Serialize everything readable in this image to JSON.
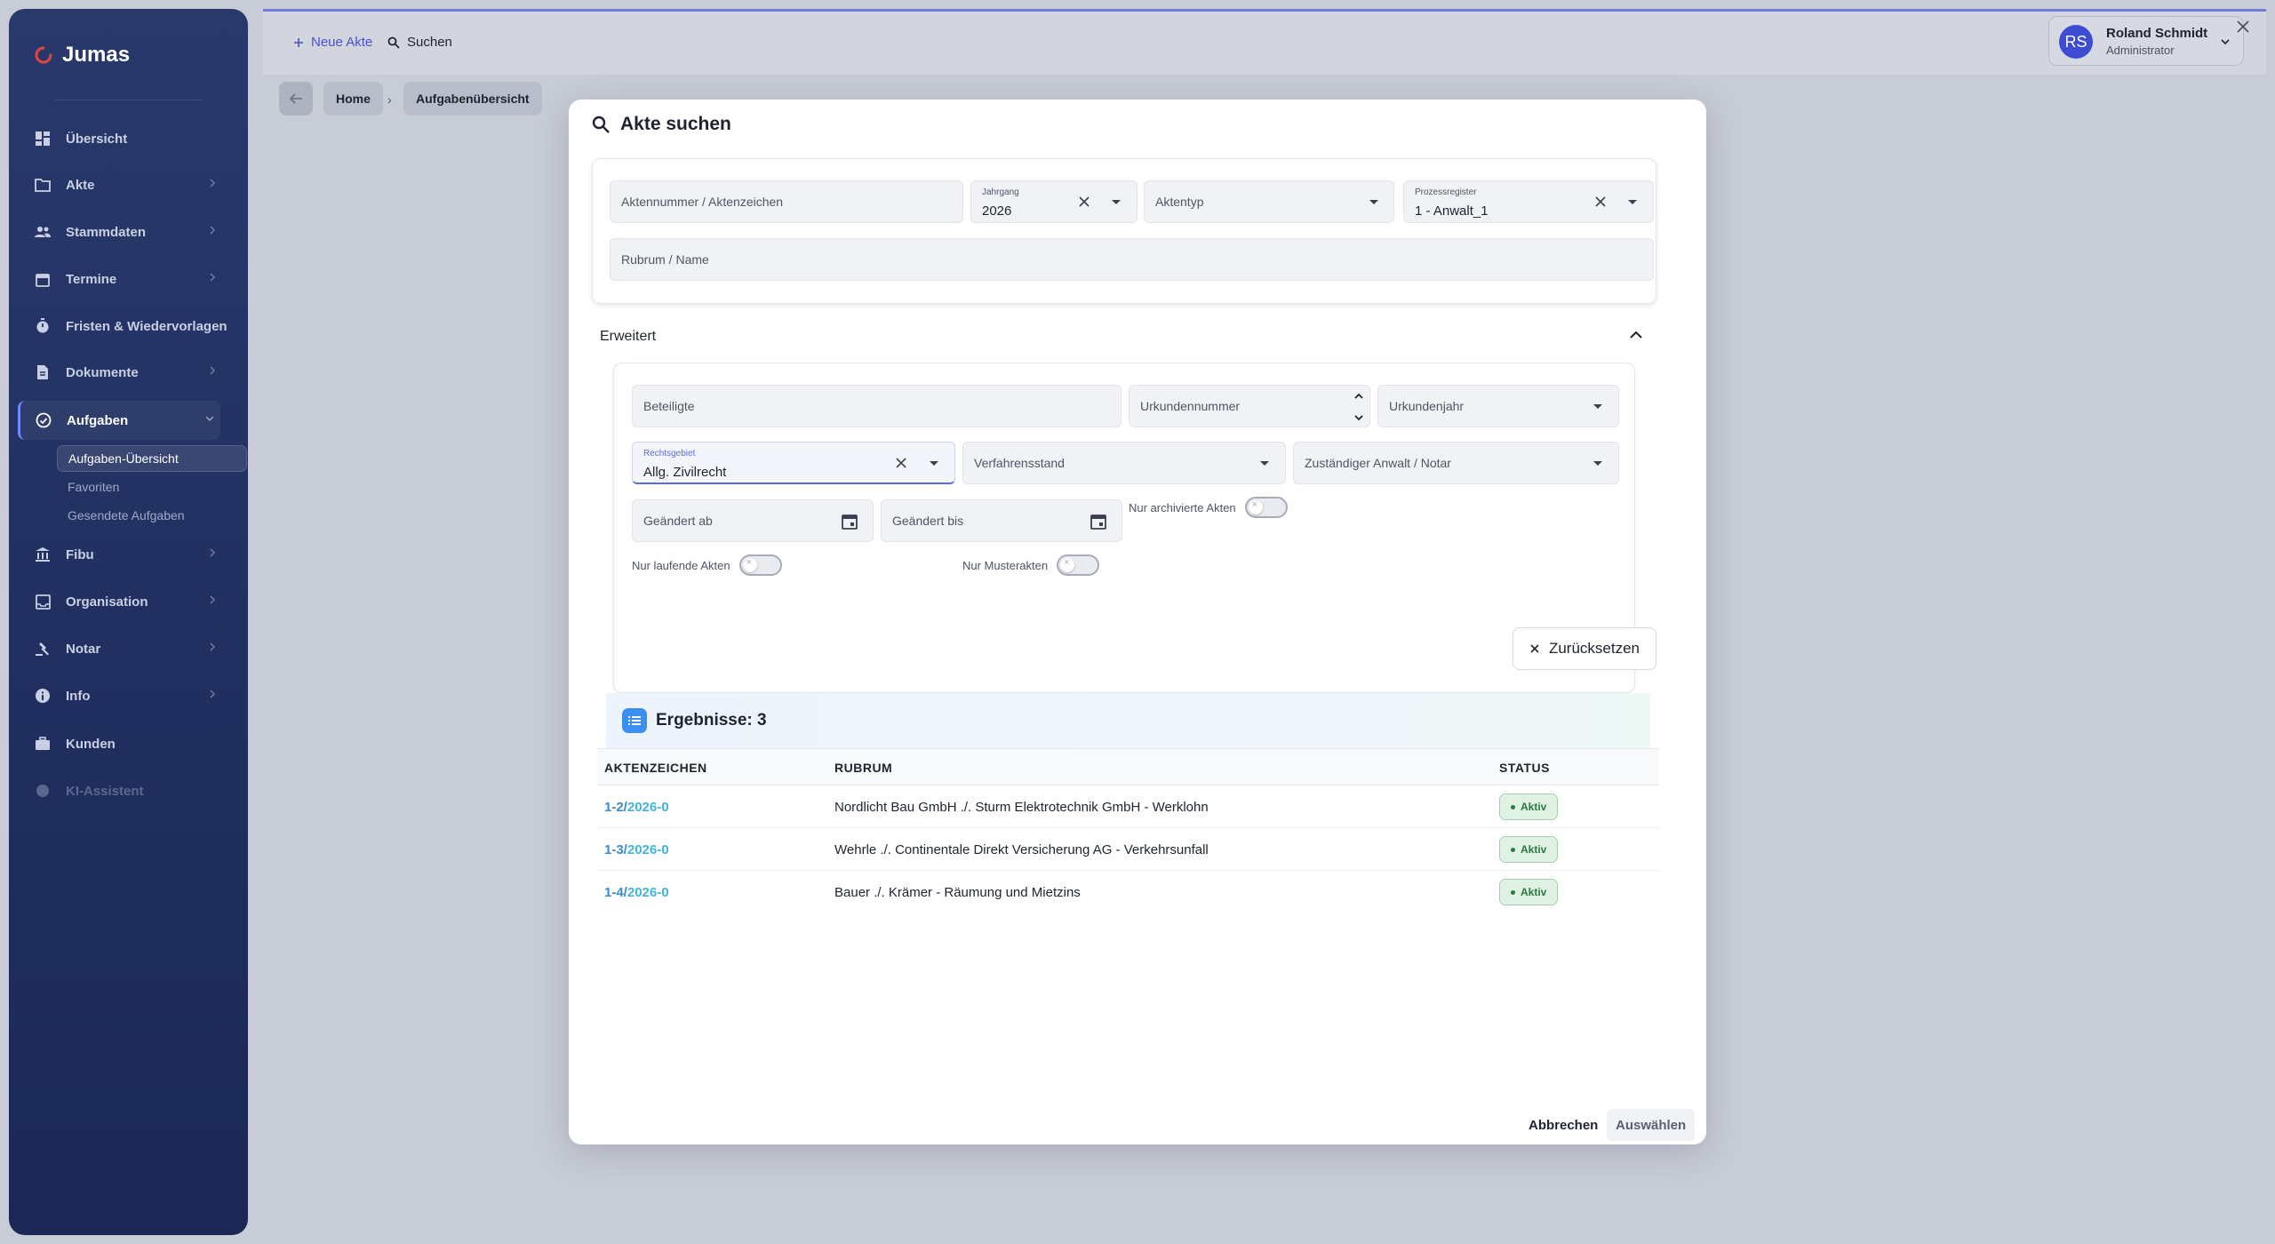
{
  "app": {
    "name": "Jumas"
  },
  "sidebar": {
    "items": [
      {
        "label": "Übersicht",
        "icon": "dashboard-icon"
      },
      {
        "label": "Akte",
        "icon": "folder-icon"
      },
      {
        "label": "Stammdaten",
        "icon": "people-icon"
      },
      {
        "label": "Termine",
        "icon": "calendar-icon"
      },
      {
        "label": "Fristen & Wiedervorlagen",
        "icon": "timer-icon"
      },
      {
        "label": "Dokumente",
        "icon": "document-icon"
      },
      {
        "label": "Aufgaben",
        "icon": "check-circle-icon"
      },
      {
        "label": "Fibu",
        "icon": "bank-icon"
      },
      {
        "label": "Organisation",
        "icon": "inbox-icon"
      },
      {
        "label": "Notar",
        "icon": "gavel-icon"
      },
      {
        "label": "Info",
        "icon": "info-icon"
      },
      {
        "label": "Kunden",
        "icon": "briefcase-icon"
      },
      {
        "label": "KI-Assistent",
        "icon": "sparkle-icon"
      }
    ],
    "subitems": [
      "Aufgaben-Übersicht",
      "Favoriten",
      "Gesendete Aufgaben"
    ]
  },
  "topbar": {
    "new_file": "Neue Akte",
    "search": "Suchen",
    "user": {
      "initials": "RS",
      "name": "Roland Schmidt",
      "role": "Administrator"
    }
  },
  "breadcrumb": {
    "home": "Home",
    "current": "Aufgabenübersicht"
  },
  "modal": {
    "title": "Akte suchen",
    "fields": {
      "aktennummer": "Aktennummer / Aktenzeichen",
      "jahrgang_label": "Jahrgang",
      "jahrgang_value": "2026",
      "aktentyp": "Aktentyp",
      "prozessregister_label": "Prozessregister",
      "prozessregister_value": "1 - Anwalt_1",
      "rubrum": "Rubrum / Name"
    },
    "advanced": {
      "title": "Erweitert",
      "beteiligte": "Beteiligte",
      "urkundennummer": "Urkundennummer",
      "urkundenjahr": "Urkundenjahr",
      "rechtsgebiet_label": "Rechtsgebiet",
      "rechtsgebiet_value": "Allg. Zivilrecht",
      "verfahrensstand": "Verfahrensstand",
      "anwalt": "Zuständiger Anwalt / Notar",
      "geaendert_ab": "Geändert ab",
      "geaendert_bis": "Geändert bis",
      "nur_archivierte": "Nur archivierte Akten",
      "nur_laufende": "Nur laufende Akten",
      "nur_muster": "Nur Musterakten"
    },
    "reset": "Zurücksetzen",
    "results_title": "Ergebnisse: 3",
    "table": {
      "headers": [
        "AKTENZEICHEN",
        "RUBRUM",
        "STATUS"
      ],
      "rows": [
        {
          "prefix": "1-2/",
          "year": "2026-0",
          "rubrum": "Nordlicht Bau GmbH ./. Sturm Elektrotechnik GmbH - Werklohn",
          "status": "Aktiv"
        },
        {
          "prefix": "1-3/",
          "year": "2026-0",
          "rubrum": "Wehrle ./. Continentale Direkt Versicherung AG - Verkehrsunfall",
          "status": "Aktiv"
        },
        {
          "prefix": "1-4/",
          "year": "2026-0",
          "rubrum": "Bauer ./. Krämer - Räumung und Mietzins",
          "status": "Aktiv"
        }
      ]
    },
    "cancel": "Abbrechen",
    "select": "Auswählen"
  },
  "colors": {
    "accent": "#5b6ddb",
    "link": "#3b8bc9",
    "sidebar": "#223162",
    "status_active": "#2c7a3e"
  }
}
